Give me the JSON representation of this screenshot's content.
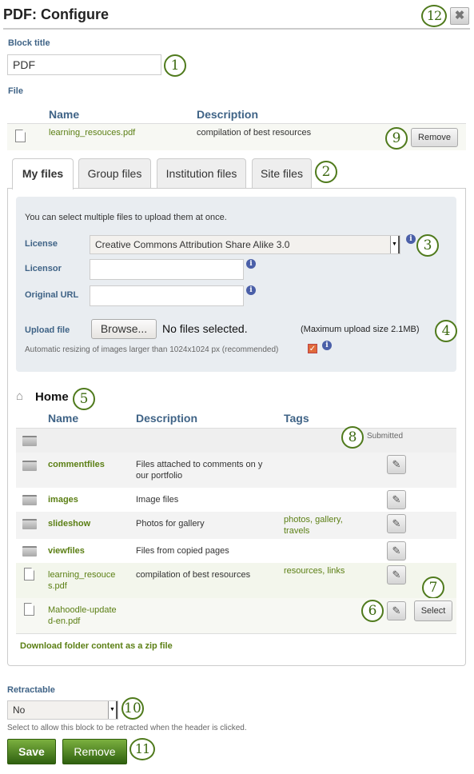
{
  "header": {
    "title": "PDF: Configure",
    "close_icon": "close-icon"
  },
  "callouts": [
    "1",
    "2",
    "3",
    "4",
    "5",
    "6",
    "7",
    "8",
    "9",
    "10",
    "11",
    "12"
  ],
  "block_title": {
    "label": "Block title",
    "value": "PDF"
  },
  "file": {
    "label": "File",
    "columns": [
      "Name",
      "Description"
    ],
    "selected": {
      "name": "learning_resouces.pdf",
      "description": "compilation of best resources",
      "remove_label": "Remove"
    }
  },
  "tabs": [
    {
      "label": "My files",
      "active": true
    },
    {
      "label": "Group files",
      "active": false
    },
    {
      "label": "Institution files",
      "active": false
    },
    {
      "label": "Site files",
      "active": false
    }
  ],
  "upload": {
    "intro": "You can select multiple files to upload them at once.",
    "license_label": "License",
    "license_value": "Creative Commons Attribution Share Alike 3.0",
    "licensor_label": "Licensor",
    "licensor_value": "",
    "original_url_label": "Original URL",
    "original_url_value": "",
    "upload_label": "Upload file",
    "browse_label": "Browse...",
    "no_files": "No files selected.",
    "max_size": "(Maximum upload size 2.1MB)",
    "resize_text": "Automatic resizing of images larger than 1024x1024 px (recommended)",
    "resize_checked": true
  },
  "browser": {
    "folder": "Home",
    "columns": [
      "Name",
      "Description",
      "Tags"
    ],
    "submitted_label": "Submitted",
    "rows": [
      {
        "type": "folder",
        "name": "",
        "description": "",
        "tags": ""
      },
      {
        "type": "folder",
        "name": "commentfiles",
        "description": "Files attached to comments on y",
        "description2": "our portfolio",
        "tags": ""
      },
      {
        "type": "folder",
        "name": "images",
        "description": "Image files",
        "tags": ""
      },
      {
        "type": "folder",
        "name": "slideshow",
        "description": "Photos for gallery",
        "tags": "photos, gallery,",
        "tags2": "travels"
      },
      {
        "type": "folder",
        "name": "viewfiles",
        "description": "Files from copied pages",
        "tags": ""
      },
      {
        "type": "file",
        "name": "learning_resouce",
        "name2": "s.pdf",
        "description": "compilation of best resources",
        "tags": "resources, links"
      },
      {
        "type": "file",
        "name": "Mahoodle-update",
        "name2": "d-en.pdf",
        "description": "",
        "tags": "",
        "select_label": "Select"
      }
    ],
    "download_zip": "Download folder content as a zip file"
  },
  "retractable": {
    "label": "Retractable",
    "value": "No",
    "help": "Select to allow this block to be retracted when the header is clicked."
  },
  "actions": {
    "save": "Save",
    "remove": "Remove"
  }
}
